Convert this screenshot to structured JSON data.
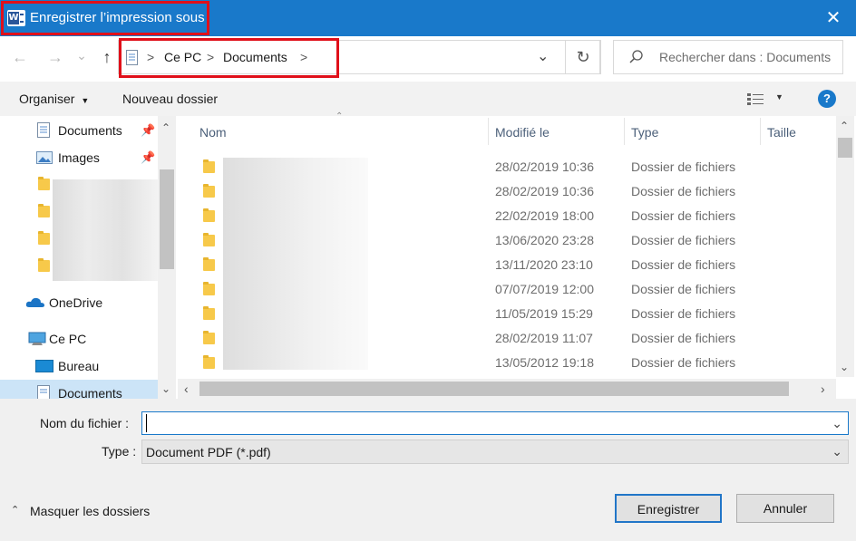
{
  "window": {
    "title": "Enregistrer l’impression sous",
    "close_glyph": "✕",
    "app_icon_letter": "W"
  },
  "nav": {
    "back_glyph": "←",
    "forward_glyph": "→",
    "recent_glyph": "⌄",
    "up_glyph": "↑",
    "breadcrumb": [
      "Ce PC",
      "Documents"
    ],
    "separator": ">",
    "dropdown_glyph": "⌄",
    "refresh_glyph": "↻",
    "search_placeholder": "Rechercher dans : Documents"
  },
  "toolbar": {
    "organize_label": "Organiser",
    "new_folder_label": "Nouveau dossier",
    "help_glyph": "?"
  },
  "sidebar": {
    "items": [
      {
        "label": "Documents",
        "icon": "document-icon",
        "pinned": true
      },
      {
        "label": "Images",
        "icon": "image-icon",
        "pinned": true
      },
      {
        "label": "OneDrive",
        "icon": "onedrive-icon"
      },
      {
        "label": "Ce PC",
        "icon": "pc-icon"
      },
      {
        "label": "Bureau",
        "icon": "desktop-icon"
      },
      {
        "label": "Documents",
        "icon": "document-icon",
        "selected": true
      }
    ]
  },
  "filelist": {
    "columns": [
      "Nom",
      "Modifié le",
      "Type",
      "Taille"
    ],
    "rows": [
      {
        "date": "28/02/2019 10:36",
        "type": "Dossier de fichiers"
      },
      {
        "date": "28/02/2019 10:36",
        "type": "Dossier de fichiers"
      },
      {
        "date": "22/02/2019 18:00",
        "type": "Dossier de fichiers"
      },
      {
        "date": "13/06/2020 23:28",
        "type": "Dossier de fichiers"
      },
      {
        "date": "13/11/2020 23:10",
        "type": "Dossier de fichiers"
      },
      {
        "date": "07/07/2019 12:00",
        "type": "Dossier de fichiers"
      },
      {
        "date": "11/05/2019 15:29",
        "type": "Dossier de fichiers"
      },
      {
        "date": "28/02/2019 11:07",
        "type": "Dossier de fichiers"
      },
      {
        "date": "13/05/2012 19:18",
        "type": "Dossier de fichiers"
      }
    ]
  },
  "form": {
    "filename_label": "Nom du fichier :",
    "filename_value": "",
    "type_label": "Type :",
    "type_value": "Document PDF (*.pdf)"
  },
  "footer": {
    "hide_folders_label": "Masquer les dossiers",
    "save_label": "Enregistrer",
    "cancel_label": "Annuler"
  },
  "colors": {
    "titlebar": "#1979ca",
    "highlight": "#e0101a",
    "folder": "#f7c94a"
  }
}
